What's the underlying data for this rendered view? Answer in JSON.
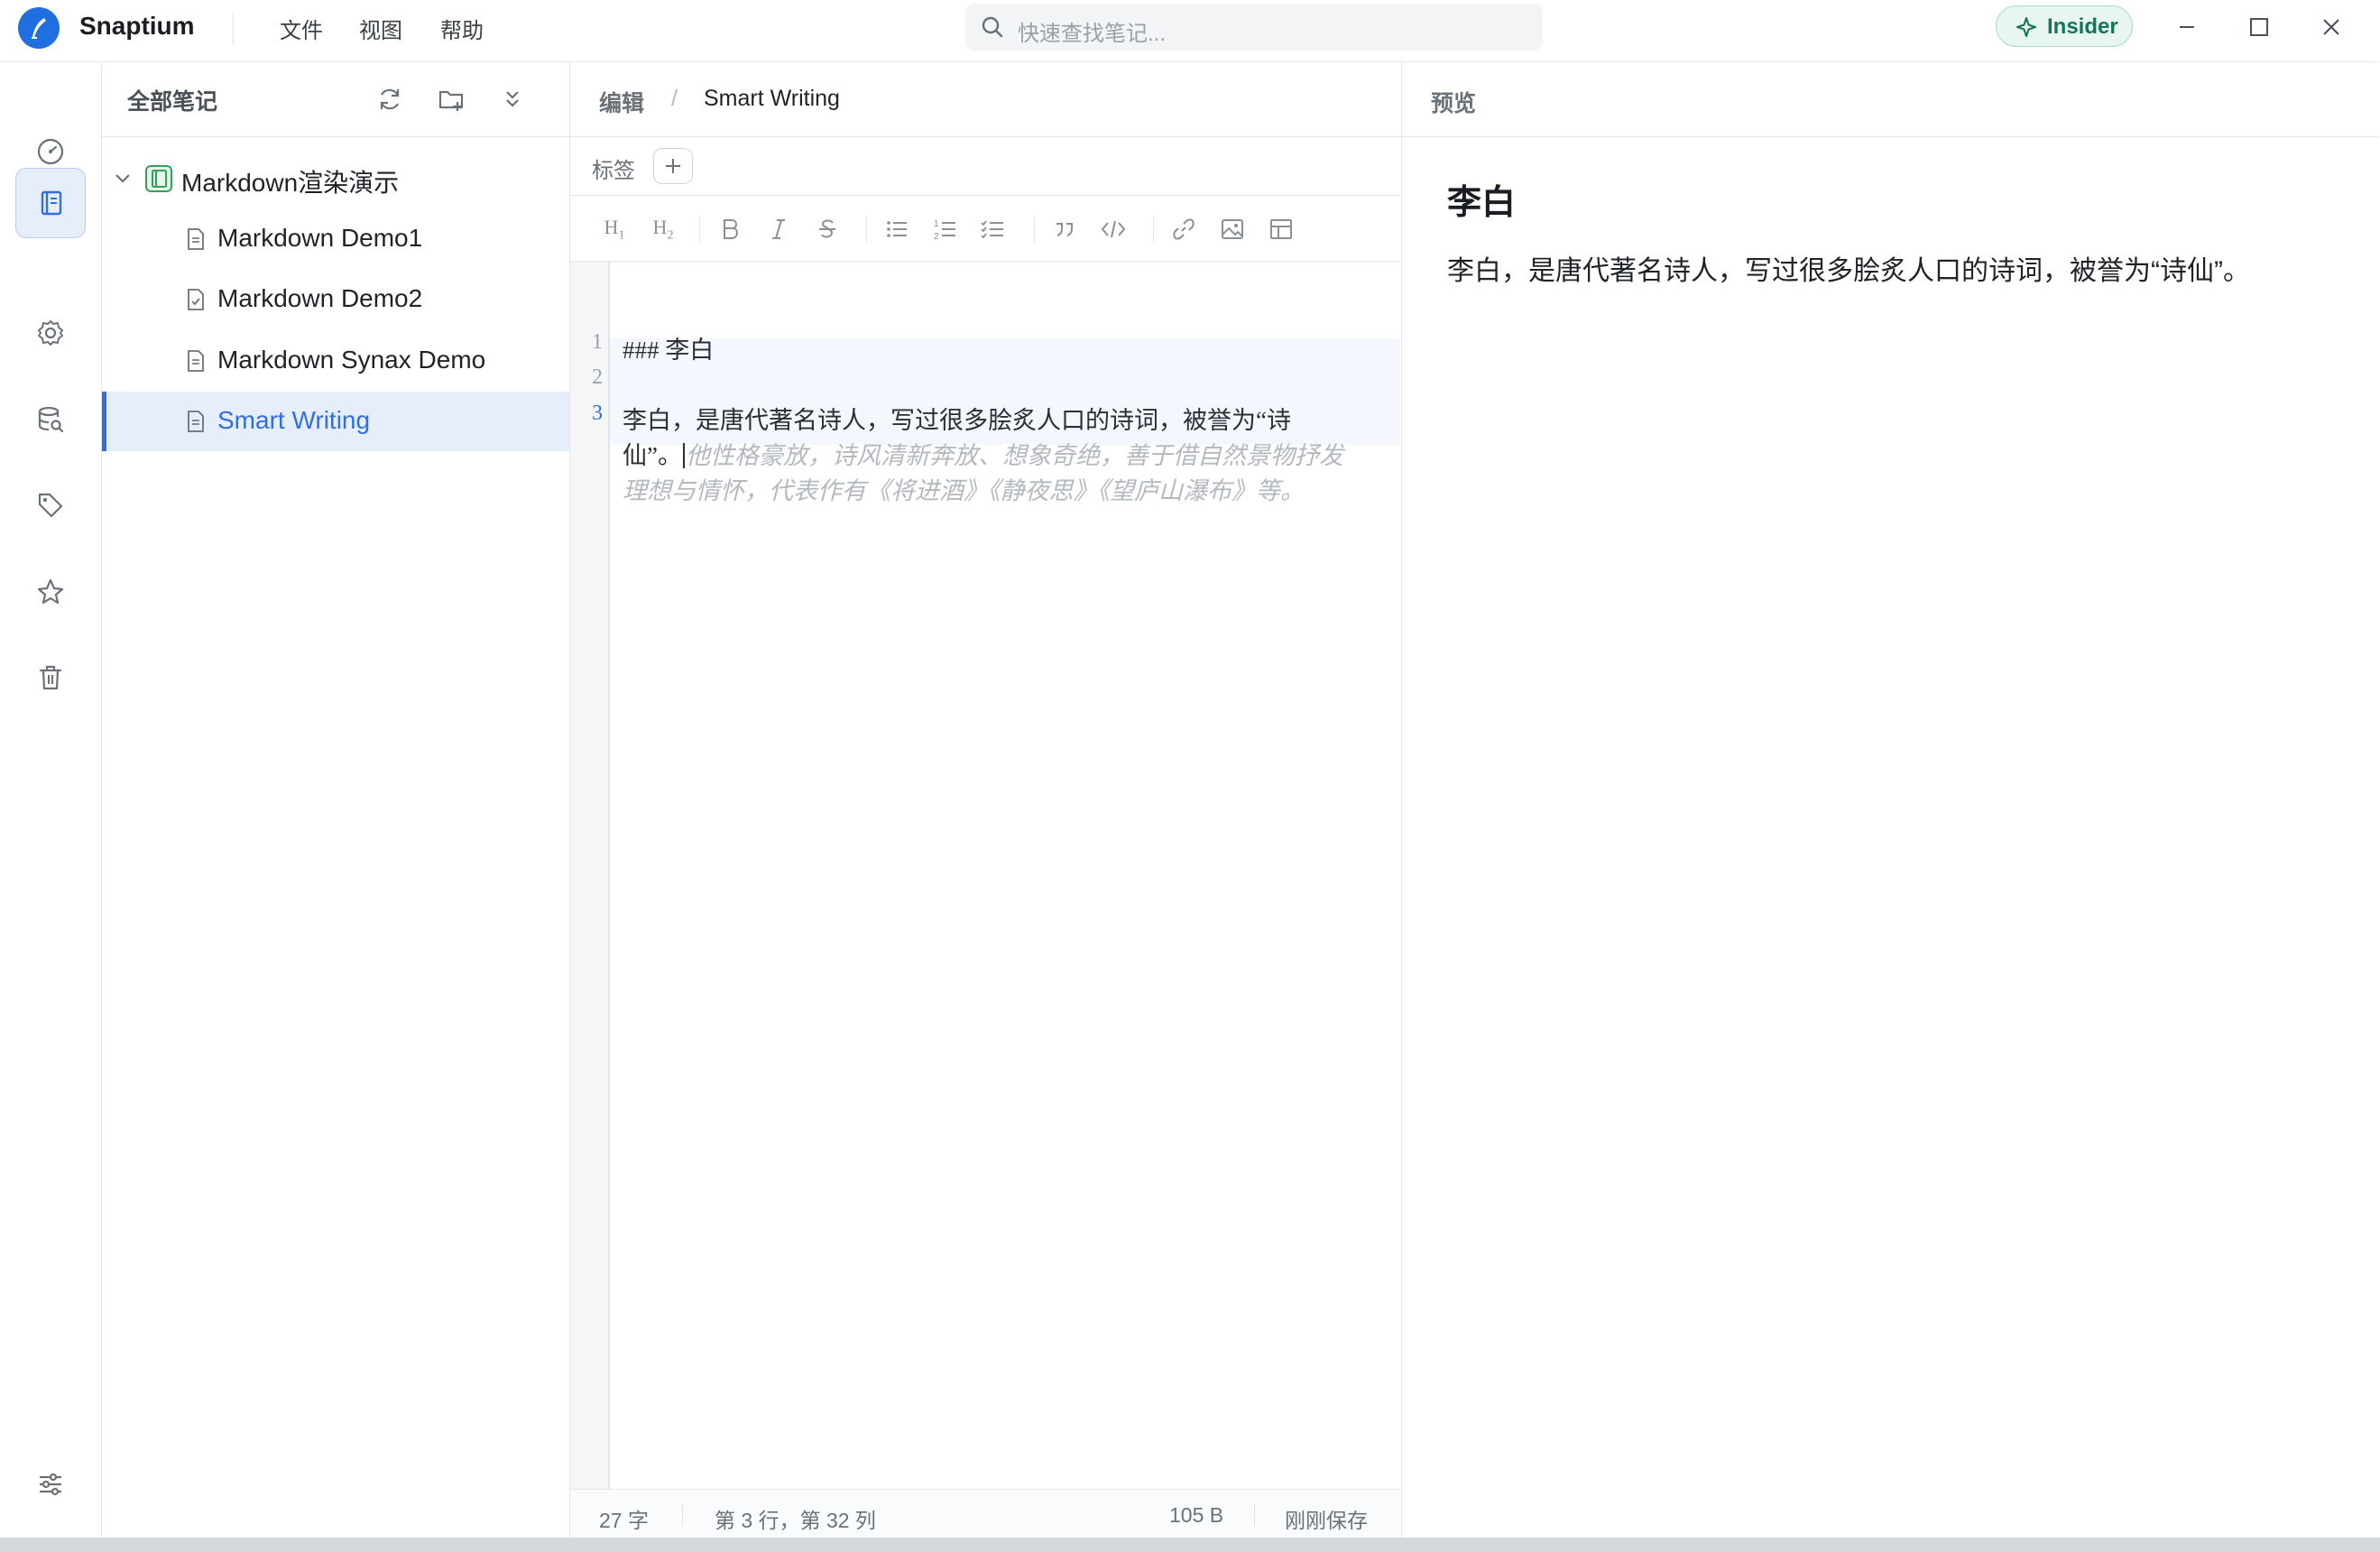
{
  "app": {
    "name": "Snaptium",
    "menu": [
      "文件",
      "视图",
      "帮助"
    ],
    "search_placeholder": "快速查找笔记...",
    "insider_label": "Insider"
  },
  "sidebar_rail": {
    "items": [
      "dashboard-icon",
      "notebook-icon",
      "settings-icon",
      "database-search-icon",
      "tag-icon",
      "star-icon",
      "trash-icon"
    ],
    "active": "notebook-icon",
    "bottom": "preferences-sliders-icon"
  },
  "notes_tree": {
    "title": "全部笔记",
    "folder": "Markdown渲染演示",
    "notes": [
      "Markdown Demo1",
      "Markdown Demo2",
      "Markdown Synax Demo",
      "Smart Writing"
    ],
    "selected": "Smart Writing"
  },
  "editor": {
    "crumb_root": "编辑",
    "crumb_sep": "/",
    "crumb_note": "Smart Writing",
    "tags_label": "标签",
    "toolbar": [
      "H1",
      "H2",
      "B",
      "I",
      "S",
      "bullet-list",
      "ordered-list",
      "task-list",
      "quote",
      "code",
      "link",
      "image",
      "table"
    ],
    "line_numbers": [
      "1",
      "2",
      "3"
    ],
    "line1": "### 李白",
    "line3_a": "李白，是唐代著名诗人，写过很多脍炙人口的诗词，被誉为“诗",
    "line3_b": "仙”。",
    "suggestion_a": "他性格豪放，诗风清新奔放、想象奇绝，善于借自然景物抒发",
    "suggestion_b": "理想与情怀，代表作有《将进酒》《静夜思》《望庐山瀑布》等。",
    "status": {
      "words": "27 字",
      "cursor": "第 3 行，第 32 列",
      "size": "105 B",
      "saved": "刚刚保存"
    }
  },
  "preview": {
    "label": "预览",
    "heading": "李白",
    "paragraph": "李白，是唐代著名诗人，写过很多脍炙人口的诗词，被誉为“诗仙”。"
  },
  "colors": {
    "accent": "#2f6fe0",
    "folder_green": "#2fa35a",
    "insider_green": "#15735a"
  }
}
